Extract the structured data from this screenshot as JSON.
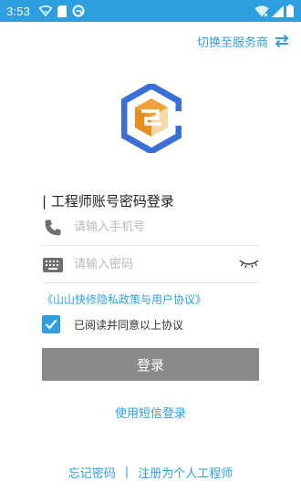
{
  "status_bar": {
    "time": "3:53",
    "icons": [
      "wifi-calling-icon",
      "sim-card-icon",
      "app-notification-icon",
      "wifi-icon",
      "cellular-signal-icon",
      "battery-icon"
    ]
  },
  "header": {
    "switch_provider_label": "切换至服务商"
  },
  "login": {
    "title": "| 工程师账号密码登录",
    "phone_placeholder": "请输入手机号",
    "password_placeholder": "请输入密码",
    "privacy_link": "《山山快修隐私政策与用户协议》",
    "agree_text": "已阅读并同意以上协议",
    "agree_checked": true,
    "login_button": "登录",
    "sms_login": "使用短信登录"
  },
  "footer": {
    "forgot_password": "忘记密码",
    "separator": "|",
    "register": "注册为个人工程师"
  },
  "colors": {
    "accent": "#2d9fe0",
    "logo_blue": "#3a6fd8",
    "logo_orange": "#f0a23a",
    "button_disabled": "#8a8a8a"
  }
}
